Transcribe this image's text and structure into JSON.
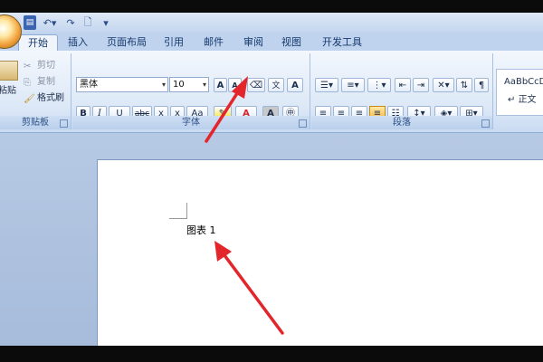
{
  "quick_access": {
    "save_icon": "save-icon",
    "undo_icon": "undo-icon",
    "redo_icon": "redo-icon",
    "print_preview_icon": "print-preview-icon",
    "customize_icon": "customize-toolbar-icon"
  },
  "tabs": [
    "开始",
    "插入",
    "页面布局",
    "引用",
    "邮件",
    "审阅",
    "视图",
    "开发工具"
  ],
  "active_tab": "开始",
  "clipboard": {
    "paste_label": "粘贴",
    "cut_label": "剪切",
    "copy_label": "复制",
    "format_painter_label": "格式刷",
    "group_label": "剪贴板"
  },
  "font": {
    "font_name": "黑体",
    "font_size": "10",
    "grow_label": "A",
    "shrink_label": "A",
    "bold": "B",
    "italic": "I",
    "underline": "U",
    "strikethrough": "abc",
    "subscript": "x",
    "superscript": "x",
    "change_case": "Aa",
    "font_color": "A",
    "char_shading": "A",
    "group_label": "字体"
  },
  "paragraph": {
    "group_label": "段落"
  },
  "styles": {
    "preview": "AaBbCcD",
    "normal_label": "正文"
  },
  "document": {
    "text": "图表 1"
  },
  "colors": {
    "annotation_arrow": "#e2262b",
    "highlight": "#f7e12a",
    "font_color": "#d8262b"
  }
}
